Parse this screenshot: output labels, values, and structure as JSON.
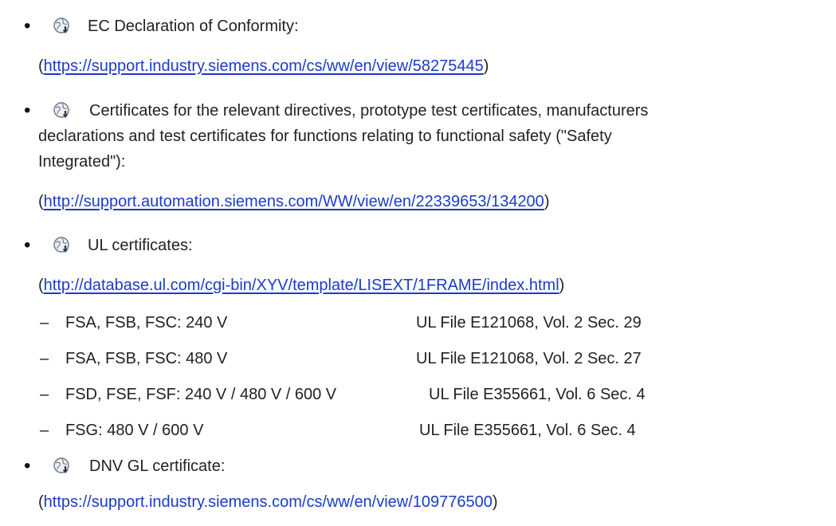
{
  "items": [
    {
      "label": "EC Declaration of Conformity:",
      "url": "https://support.industry.siemens.com/cs/ww/en/view/58275445"
    },
    {
      "label_lines": [
        "Certificates for the relevant directives, prototype test certificates, manufacturers",
        "declarations and test certificates for functions relating to functional safety (\"Safety",
        "Integrated\"):"
      ],
      "url": "http://support.automation.siemens.com/WW/view/en/22339653/134200"
    },
    {
      "label": "UL certificates:",
      "url": "http://database.ul.com/cgi-bin/XYV/template/LISEXT/1FRAME/index.html",
      "sub_items": [
        {
          "left": "FSA, FSB, FSC: 240 V",
          "right": "UL File E121068, Vol. 2 Sec. 29"
        },
        {
          "left": "FSA, FSB, FSC: 480 V",
          "right": "UL File E121068, Vol. 2 Sec. 27"
        },
        {
          "left": "FSD, FSE, FSF: 240 V / 480 V / 600 V",
          "right": "UL File E355661, Vol. 6 Sec. 4"
        },
        {
          "left": "FSG: 480 V / 600 V",
          "right": "UL File E355661, Vol. 6 Sec. 4"
        }
      ]
    },
    {
      "label": "DNV GL certificate:",
      "url": "https://support.industry.siemens.com/cs/ww/en/view/109776500"
    }
  ],
  "glyphs": {
    "bullet": "•",
    "dash": "–",
    "open_paren": "(",
    "close_paren": ")"
  },
  "icon_name": "globe-download-icon",
  "colors": {
    "link": "#1a3cc8",
    "text": "#222222"
  }
}
